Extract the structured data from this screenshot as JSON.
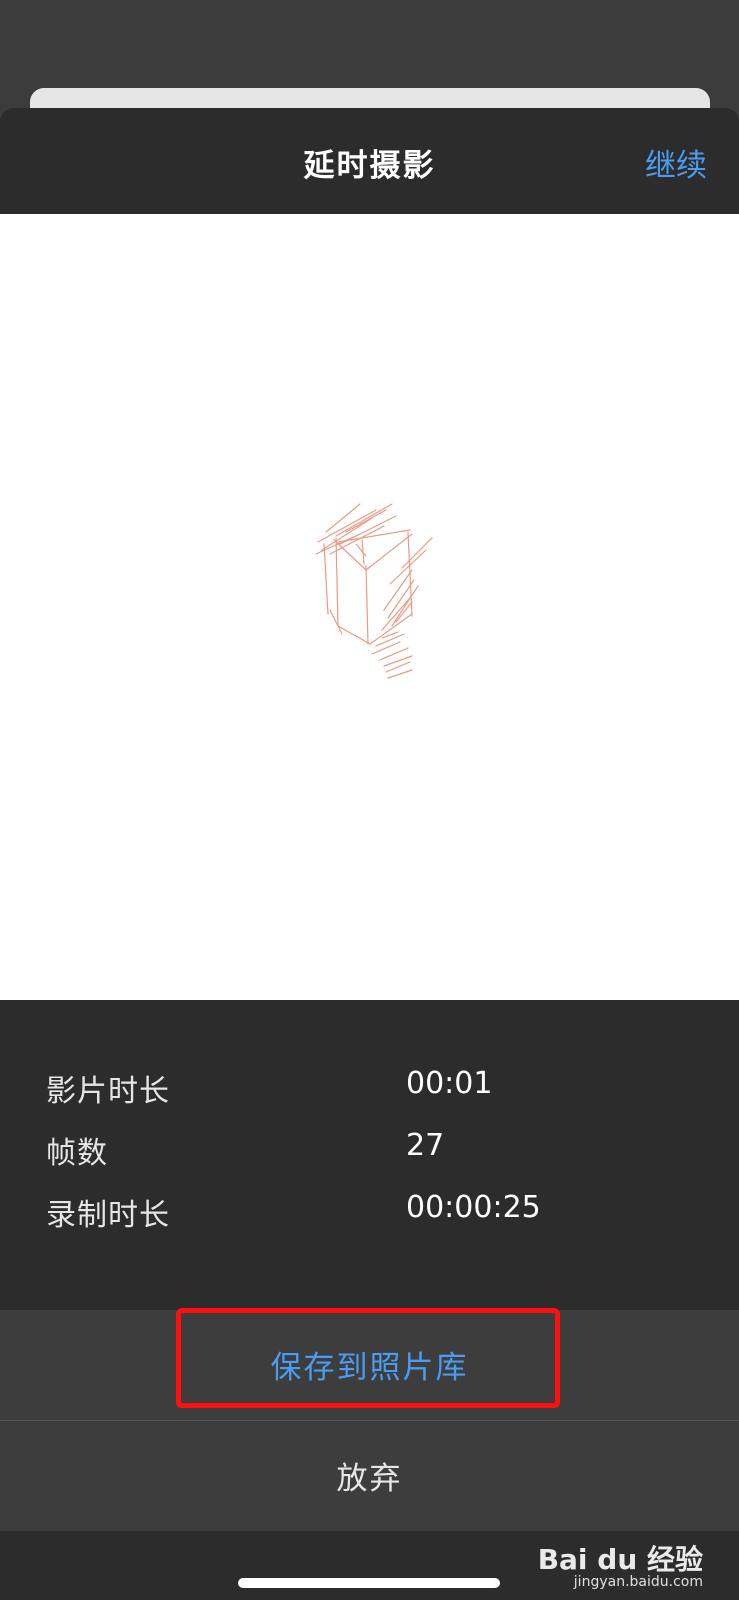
{
  "header": {
    "title": "延时摄影",
    "continue_label": "继续"
  },
  "info": {
    "rows": [
      {
        "label": "影片时长",
        "value": "00:01"
      },
      {
        "label": "帧数",
        "value": "27"
      },
      {
        "label": "录制时长",
        "value": "00:00:25"
      }
    ]
  },
  "actions": {
    "save_label": "保存到照片库",
    "discard_label": "放弃"
  },
  "watermark": {
    "logo_text": "Bai du 经验",
    "url": "jingyan.baidu.com"
  },
  "colors": {
    "accent": "#4a9cf0",
    "sheet": "#2c2c2c",
    "button_bg": "#3d3d3d",
    "highlight": "#ff1010",
    "sketch_stroke": "#e8907a"
  }
}
